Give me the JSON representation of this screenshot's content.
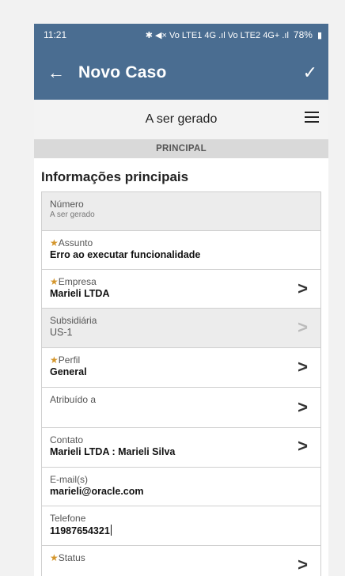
{
  "status_bar": {
    "time": "11:21",
    "indicators": "✱ ◀× Vo LTE1 4G .ıl Vo LTE2 4G+ .ıl",
    "battery": "78%"
  },
  "app_bar": {
    "title": "Novo Caso"
  },
  "subheader": {
    "title": "A ser gerado"
  },
  "tab": {
    "label": "PRINCIPAL"
  },
  "section": {
    "title": "Informações principais"
  },
  "fields": [
    {
      "label": "Número",
      "value": "A ser gerado"
    },
    {
      "label": "Assunto",
      "value": "Erro ao executar funcionalidade"
    },
    {
      "label": "Empresa",
      "value": "Marieli LTDA"
    },
    {
      "label": "Subsidiária",
      "value": "US-1"
    },
    {
      "label": "Perfil",
      "value": "General"
    },
    {
      "label": "Atribuído a",
      "value": ""
    },
    {
      "label": "Contato",
      "value": "Marieli LTDA : Marieli Silva"
    },
    {
      "label": "E-mail(s)",
      "value": "marieli@oracle.com"
    },
    {
      "label": "Telefone",
      "value": "11987654321"
    },
    {
      "label": "Status",
      "value": ""
    }
  ],
  "required_marker": "★",
  "colors": {
    "header_bg": "#4a6d91",
    "required": "#d4962c"
  }
}
